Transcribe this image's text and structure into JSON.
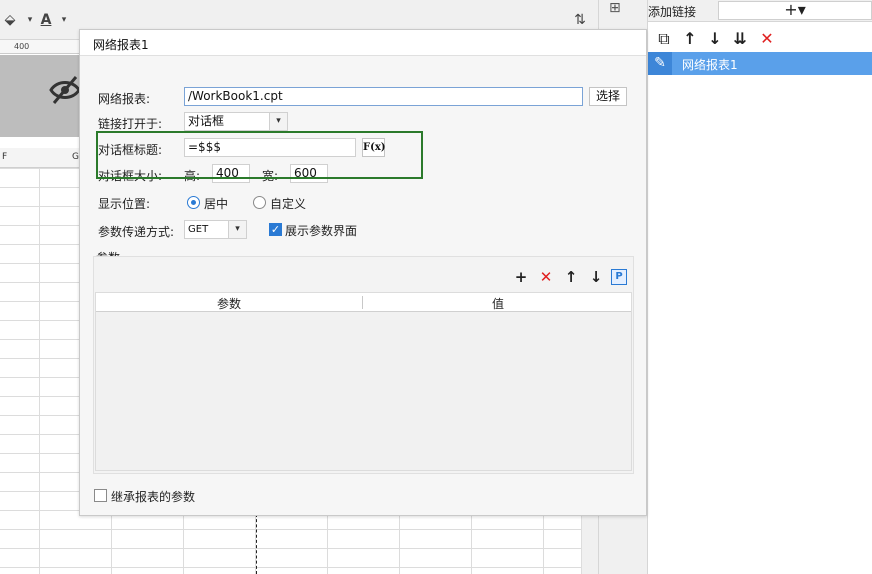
{
  "spreadsheet": {
    "ruler_value": "400",
    "column_f": "F",
    "column_g": "G"
  },
  "right_panel": {
    "title": "添加链接",
    "add_symbol": "+▾",
    "list_item": "网络报表1"
  },
  "dialog": {
    "title": "网络报表1",
    "report_label": "网络报表:",
    "report_value": "/WorkBook1.cpt",
    "choose_button": "选择",
    "open_in_label": "链接打开于:",
    "open_in_value": "对话框",
    "dialog_title_label": "对话框标题:",
    "dialog_title_value": "=$$$",
    "formula_button": "F(x)",
    "dialog_size_label": "对话框大小:",
    "height_label": "高:",
    "height_value": "400",
    "width_label": "宽:",
    "width_value": "600",
    "position_label": "显示位置:",
    "position_center": "居中",
    "position_custom": "自定义",
    "param_method_label": "参数传递方式:",
    "param_method_value": "GET",
    "show_param_label": "展示参数界面",
    "params_group_label": "参数",
    "col_param": "参数",
    "col_value": "值",
    "param_p_button": "P",
    "inherit_label": "继承报表的参数"
  },
  "colors": {
    "accent": "#2a7ad4",
    "selected_row": "#5aa0ea",
    "highlight_box": "#2b7a2b",
    "delete_red": "#e02020"
  }
}
